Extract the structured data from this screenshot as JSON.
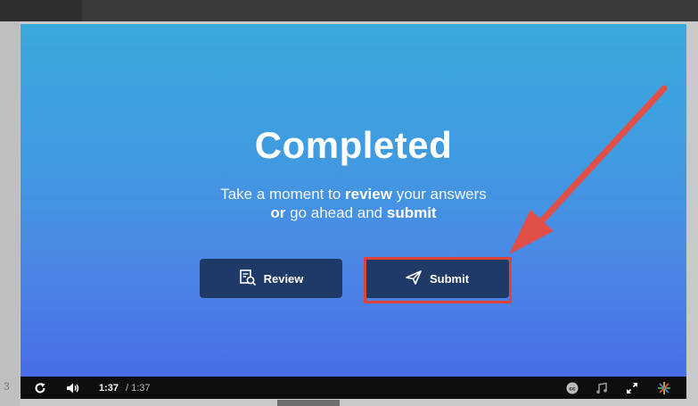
{
  "slide": {
    "title": "Completed",
    "subtitle_line1_pre": "Take a moment to ",
    "subtitle_line1_bold": "review",
    "subtitle_line1_post": " your answers",
    "subtitle_line2_bold1": "or",
    "subtitle_line2_mid": " go ahead and ",
    "subtitle_line2_bold2": "submit"
  },
  "buttons": {
    "review_label": "Review",
    "submit_label": "Submit"
  },
  "player": {
    "time_current": "1:37",
    "time_total": "/ 1:37"
  },
  "side_label": "3",
  "colors": {
    "button_bg": "#203a67",
    "highlight": "#e0433a",
    "arrow": "#e05048"
  },
  "icons": [
    "replay-icon",
    "volume-icon",
    "review-icon",
    "send-icon",
    "closed-captions-icon",
    "music-icon",
    "fullscreen-icon",
    "logo-icon"
  ]
}
